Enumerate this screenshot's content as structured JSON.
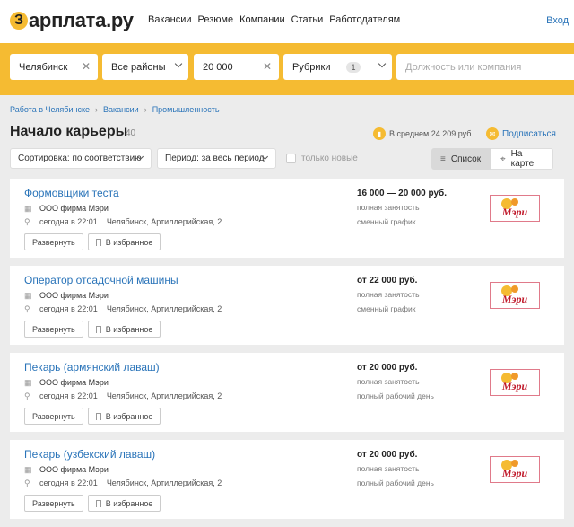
{
  "header": {
    "logo_glyph": "З",
    "logo_text": "арплата.ру",
    "nav": [
      "Вакансии",
      "Резюме",
      "Компании",
      "Статьи",
      "Работодателям"
    ],
    "login": "Вход"
  },
  "search": {
    "city": "Челябинск",
    "district": "Все районы",
    "salary": "20 000",
    "rubrics_label": "Рубрики",
    "rubrics_count": "1",
    "query_placeholder": "Должность или компания"
  },
  "breadcrumb": [
    "Работа в Челябинске",
    "Вакансии",
    "Промышленность"
  ],
  "page": {
    "title": "Начало карьеры",
    "count": "40",
    "avg_salary": "В среднем 24 209 руб.",
    "subscribe": "Подписаться"
  },
  "filters": {
    "sort": "Сортировка: по соответствию",
    "period": "Период: за весь период",
    "only_new": "только новые",
    "view_list": "Список",
    "view_map": "На карте"
  },
  "card_labels": {
    "expand": "Развернуть",
    "favorite": "В избранное"
  },
  "vacancies": [
    {
      "title": "Формовщики теста",
      "company": "ООО фирма Мэри",
      "date": "сегодня в 22:01",
      "address": "Челябинск, Артиллерийская, 2",
      "salary": "16 000 — 20 000 руб.",
      "employment": "полная занятость",
      "schedule": "сменный график"
    },
    {
      "title": "Оператор отсадочной машины",
      "company": "ООО фирма Мэри",
      "date": "сегодня в 22:01",
      "address": "Челябинск, Артиллерийская, 2",
      "salary": "от 22 000 руб.",
      "employment": "полная занятость",
      "schedule": "сменный график"
    },
    {
      "title": "Пекарь (армянский лаваш)",
      "company": "ООО фирма Мэри",
      "date": "сегодня в 22:01",
      "address": "Челябинск, Артиллерийская, 2",
      "salary": "от 20 000 руб.",
      "employment": "полная занятость",
      "schedule": "полный рабочий день"
    },
    {
      "title": "Пекарь (узбекский лаваш)",
      "company": "ООО фирма Мэри",
      "date": "сегодня в 22:01",
      "address": "Челябинск, Артиллерийская, 2",
      "salary": "от 20 000 руб.",
      "employment": "полная занятость",
      "schedule": "полный рабочий день"
    }
  ],
  "company_logo_text": "Мэри",
  "colors": {
    "brand_yellow": "#f5bb32",
    "link_blue": "#2a74b9",
    "background": "#ececec"
  },
  "icons": [
    "building-icon",
    "location-icon",
    "bookmark-icon",
    "chart-icon",
    "mail-icon",
    "list-icon",
    "map-pin-icon",
    "clear-icon",
    "chevron-down-icon"
  ]
}
